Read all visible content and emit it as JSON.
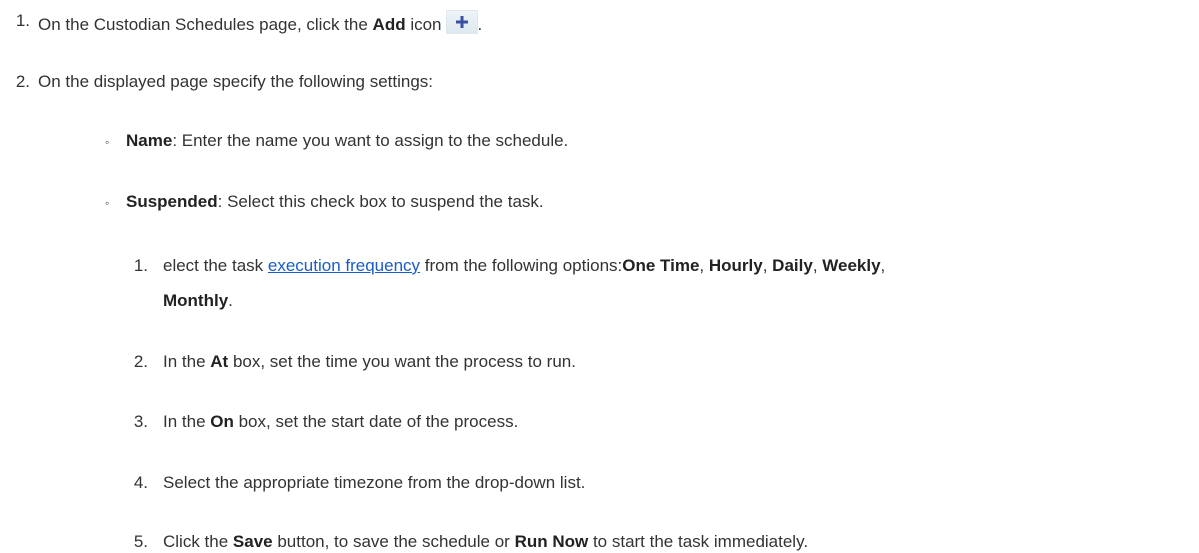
{
  "steps": {
    "step1": {
      "number": "1.",
      "text_before": "On the Custodian Schedules  page, click the ",
      "bold": "Add",
      "text_after": " icon",
      "end": "."
    },
    "step2": {
      "number": "2.",
      "text": "On the displayed page specify the following settings:"
    },
    "settings": [
      {
        "bullet": "◦",
        "bold": "Name",
        "text": ": Enter the name you want to assign to the schedule."
      },
      {
        "bullet": "◦",
        "bold": "Suspended",
        "text": ": Select this check box to suspend the task."
      }
    ],
    "substeps": {
      "s1": {
        "number": "1.",
        "text_before": "elect the task ",
        "link": "execution frequency",
        "text_mid": " from the following options:",
        "opt1": "One Time",
        "sep1": ", ",
        "opt2": "Hourly",
        "sep2": ", ",
        "opt3": "Daily",
        "sep3": ", ",
        "opt4": "Weekly",
        "sep4": ",",
        "opt5": "Monthly",
        "end": "."
      },
      "s2": {
        "number": "2.",
        "text_before": "In the ",
        "bold": "At",
        "text_after": " box, set the time you want the process to run."
      },
      "s3": {
        "number": "3.",
        "text_before": "In the ",
        "bold": "On",
        "text_after": " box, set the start date of the process."
      },
      "s4": {
        "number": "4.",
        "text": "Select the appropriate timezone from the drop-down list."
      },
      "s5": {
        "number": "5.",
        "text_before": "Click the ",
        "bold1": "Save",
        "text_mid": " button, to save the schedule or ",
        "bold2": "Run Now",
        "text_after": " to start the task immediately."
      }
    }
  },
  "icons": {
    "add": "plus-icon"
  },
  "colors": {
    "link": "#1a5cc8",
    "plus": "#3a4fa0"
  }
}
